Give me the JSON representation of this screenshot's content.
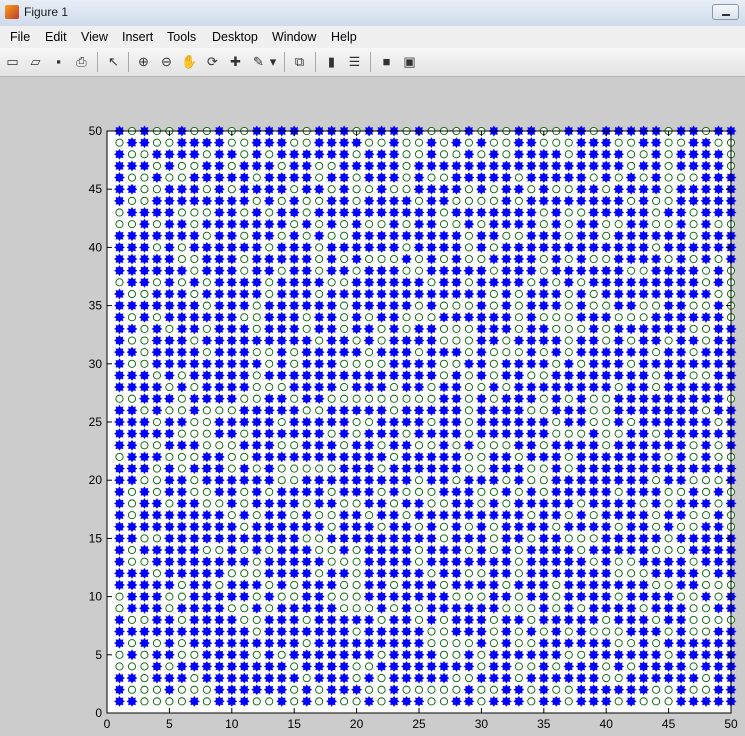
{
  "window": {
    "title": "Figure 1"
  },
  "menu": [
    "File",
    "Edit",
    "View",
    "Insert",
    "Tools",
    "Desktop",
    "Window",
    "Help"
  ],
  "toolbar_icons": [
    {
      "name": "new-figure-icon",
      "glyph": "▭"
    },
    {
      "name": "open-file-icon",
      "glyph": "▱"
    },
    {
      "name": "save-icon",
      "glyph": "▪"
    },
    {
      "name": "print-icon",
      "glyph": "⎙"
    },
    {
      "name": "select-pointer-icon",
      "glyph": "↖"
    },
    {
      "name": "zoom-in-icon",
      "glyph": "⊕"
    },
    {
      "name": "zoom-out-icon",
      "glyph": "⊖"
    },
    {
      "name": "pan-hand-icon",
      "glyph": "✋"
    },
    {
      "name": "rotate-3d-icon",
      "glyph": "⟳"
    },
    {
      "name": "data-cursor-icon",
      "glyph": "✚"
    },
    {
      "name": "brush-icon",
      "glyph": "✎"
    },
    {
      "name": "brush-dropdown-icon",
      "glyph": "▾"
    },
    {
      "name": "link-plot-icon",
      "glyph": "⧉"
    },
    {
      "name": "colorbar-icon",
      "glyph": "▮"
    },
    {
      "name": "legend-icon",
      "glyph": "☰"
    },
    {
      "name": "hide-plot-tools-icon",
      "glyph": "■"
    },
    {
      "name": "show-plot-tools-icon",
      "glyph": "▣"
    }
  ],
  "chart_data": {
    "type": "scatter",
    "title": "",
    "xlabel": "",
    "ylabel": "",
    "xlim": [
      0,
      50
    ],
    "ylim": [
      0,
      50
    ],
    "xticks": [
      0,
      5,
      10,
      15,
      20,
      25,
      30,
      35,
      40,
      45,
      50
    ],
    "yticks": [
      0,
      5,
      10,
      15,
      20,
      25,
      30,
      35,
      40,
      45,
      50
    ],
    "grid": false,
    "marker_colors": {
      "filled": "#0000ff",
      "open_edge": "#006400",
      "open_fill": "#ffffff"
    },
    "series": [
      {
        "marker": "filled-star",
        "description_points": "grid points x=1..50, y=1..50 where state=1"
      },
      {
        "marker": "open-circle",
        "description_points": "grid points x=1..50, y=1..50 where state=0"
      }
    ],
    "open_fraction_approx": 0.3,
    "seed": 20240517
  }
}
